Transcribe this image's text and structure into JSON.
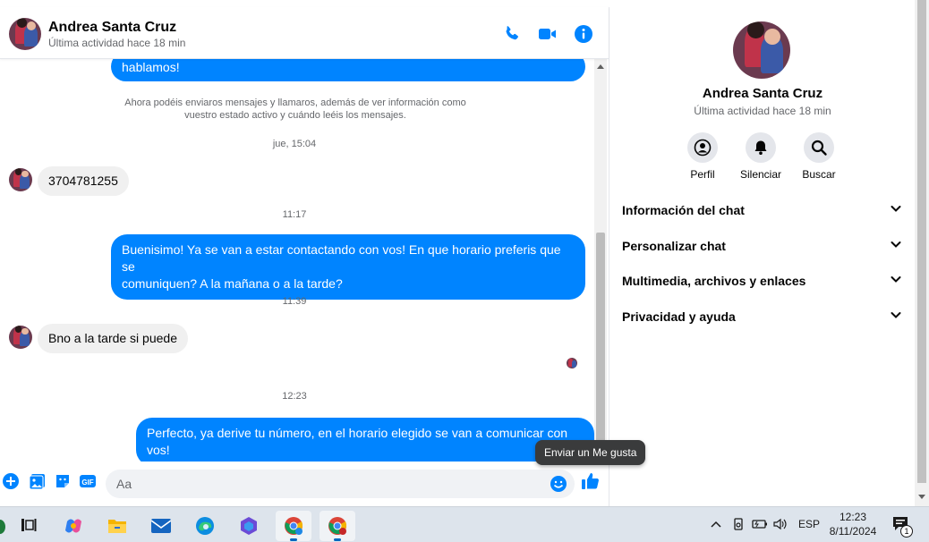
{
  "header": {
    "name": "Andrea Santa Cruz",
    "status": "Última actividad hace 18 min"
  },
  "messages": {
    "partial_top": "hablamos!",
    "system_notice_line1": "Ahora podéis enviaros mensajes y llamaros, además de ver información como",
    "system_notice_line2": "vuestro estado activo y cuándo leéis los mensajes.",
    "ts1": "jue, 15:04",
    "in1": "3704781255",
    "ts2": "11:17",
    "out1_line1": "Buenisimo! Ya se van a estar contactando con vos! En que horario preferis que se",
    "out1_line2": "comuniquen? A la mañana o a la tarde?",
    "ts3": "11:39",
    "in2": "Bno a la tarde si puede",
    "ts4": "12:23",
    "out2": "Perfecto, ya derive tu número,  en el horario elegido se van a comunicar con vos!"
  },
  "composer": {
    "placeholder": "Aa",
    "tooltip": "Enviar un Me gusta"
  },
  "info": {
    "name": "Andrea Santa Cruz",
    "status": "Última actividad hace 18 min",
    "actions": [
      {
        "label": "Perfil",
        "icon": "profile-icon"
      },
      {
        "label": "Silenciar",
        "icon": "bell-icon"
      },
      {
        "label": "Buscar",
        "icon": "search-icon"
      }
    ],
    "sections": [
      {
        "label": "Información del chat"
      },
      {
        "label": "Personalizar chat"
      },
      {
        "label": "Multimedia, archivos y enlaces"
      },
      {
        "label": "Privacidad y ayuda"
      }
    ]
  },
  "taskbar": {
    "lang": "ESP",
    "time": "12:23",
    "date": "8/11/2024",
    "notifications": "1"
  },
  "colors": {
    "accent": "#0084ff",
    "incoming_bubble": "#f0f0f0"
  }
}
